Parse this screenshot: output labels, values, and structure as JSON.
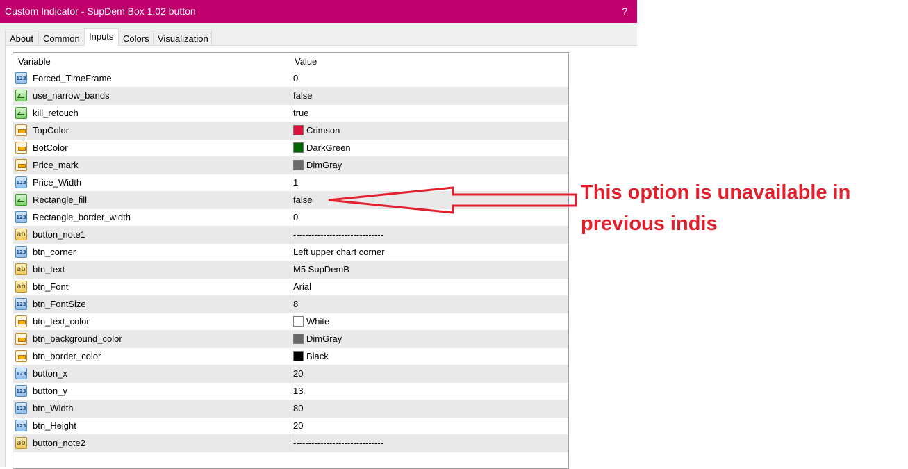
{
  "window": {
    "title": "Custom Indicator - SupDem Box 1.02 button",
    "help": "?"
  },
  "tabs": [
    "About",
    "Common",
    "Inputs",
    "Colors",
    "Visualization"
  ],
  "active_tab": "Inputs",
  "grid": {
    "headers": {
      "variable": "Variable",
      "value": "Value"
    },
    "rows": [
      {
        "name": "Forced_TimeFrame",
        "value": "0",
        "type": "number-icon"
      },
      {
        "name": "use_narrow_bands",
        "value": "false",
        "type": "boolean-icon"
      },
      {
        "name": "kill_retouch",
        "value": "true",
        "type": "boolean-icon"
      },
      {
        "name": "TopColor",
        "value": "Crimson",
        "type": "color-icon",
        "swatch": "#dc143c"
      },
      {
        "name": "BotColor",
        "value": "DarkGreen",
        "type": "color-icon",
        "swatch": "#006400"
      },
      {
        "name": "Price_mark",
        "value": "DimGray",
        "type": "color-icon",
        "swatch": "#696969"
      },
      {
        "name": "Price_Width",
        "value": "1",
        "type": "number-icon"
      },
      {
        "name": "Rectangle_fill",
        "value": "false",
        "type": "boolean-icon"
      },
      {
        "name": "Rectangle_border_width",
        "value": "0",
        "type": "number-icon"
      },
      {
        "name": "button_note1",
        "value": "------------------------------",
        "type": "text-icon"
      },
      {
        "name": "btn_corner",
        "value": "Left upper chart corner",
        "type": "number-icon"
      },
      {
        "name": "btn_text",
        "value": "M5 SupDemB",
        "type": "text-icon"
      },
      {
        "name": "btn_Font",
        "value": "Arial",
        "type": "text-icon"
      },
      {
        "name": "btn_FontSize",
        "value": "8",
        "type": "number-icon"
      },
      {
        "name": "btn_text_color",
        "value": "White",
        "type": "color-icon",
        "swatch": "#ffffff"
      },
      {
        "name": "btn_background_color",
        "value": "DimGray",
        "type": "color-icon",
        "swatch": "#696969"
      },
      {
        "name": "btn_border_color",
        "value": "Black",
        "type": "color-icon",
        "swatch": "#000000"
      },
      {
        "name": "button_x",
        "value": "20",
        "type": "number-icon"
      },
      {
        "name": "button_y",
        "value": "13",
        "type": "number-icon"
      },
      {
        "name": "btn_Width",
        "value": "80",
        "type": "number-icon"
      },
      {
        "name": "btn_Height",
        "value": "20",
        "type": "number-icon"
      },
      {
        "name": "button_note2",
        "value": "------------------------------",
        "type": "text-icon"
      }
    ]
  },
  "annotation": {
    "text_line1": "This option is unavailable in",
    "text_line2": "previous indis",
    "color": "#e21f2d"
  },
  "colors": {
    "titlebar": "#c2006d"
  }
}
